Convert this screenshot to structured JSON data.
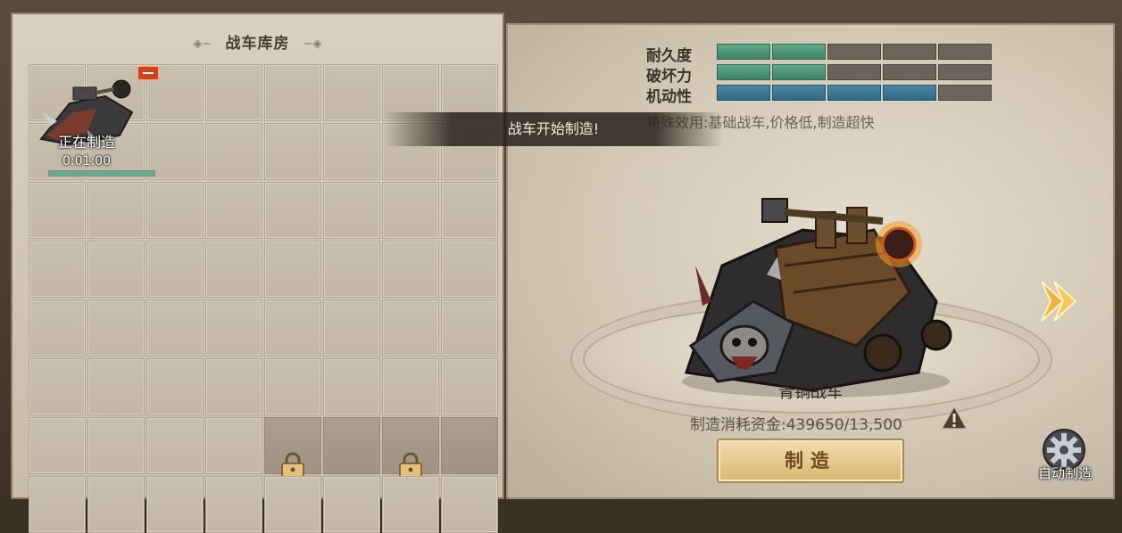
{
  "warehouse": {
    "title": "战车库房",
    "rows": 8,
    "cols": 8,
    "active_item": {
      "status": "正在制造",
      "timer": "0:01:00",
      "progress": 1.0,
      "icon": "war-cart-icon"
    },
    "locked_cells": [
      [
        6,
        4
      ],
      [
        6,
        5
      ],
      [
        6,
        6
      ],
      [
        6,
        7
      ]
    ]
  },
  "toast": {
    "message": "战车开始制造!"
  },
  "stats": [
    {
      "label": "耐久度",
      "filled": 2,
      "total": 5,
      "color": "green"
    },
    {
      "label": "破坏力",
      "filled": 2,
      "total": 5,
      "color": "green"
    },
    {
      "label": "机动性",
      "filled": 4,
      "total": 5,
      "color": "blue"
    }
  ],
  "special_effect": "特殊效用:基础战车,价格低,制造超快",
  "cart": {
    "name": "青铜战车"
  },
  "cost": {
    "label": "制造消耗资金:439650/13,500"
  },
  "buttons": {
    "build": "制造",
    "auto_build": "自动制造"
  },
  "colors": {
    "stat_green": "#4f967a",
    "stat_blue": "#3a7896",
    "progress": "#5fae8e",
    "remove_badge": "#d0431e",
    "button_text": "#6b4b1f"
  }
}
